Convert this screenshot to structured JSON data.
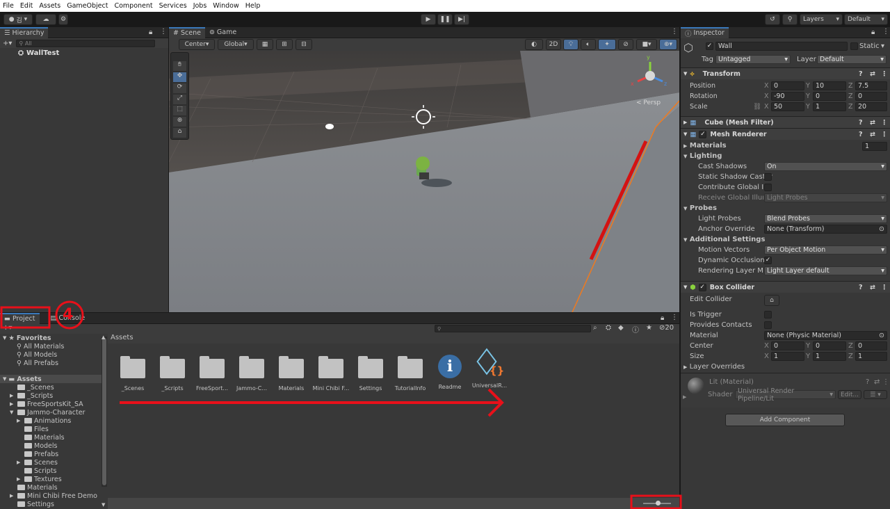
{
  "menu": [
    "File",
    "Edit",
    "Assets",
    "GameObject",
    "Component",
    "Services",
    "Jobs",
    "Window",
    "Help"
  ],
  "toolbar": {
    "account": "김",
    "layers": "Layers",
    "layout": "Default"
  },
  "hierarchy": {
    "tab": "Hierarchy",
    "search_placeholder": "All",
    "root": "WallTest"
  },
  "scene": {
    "tabs": [
      "Scene",
      "Game"
    ],
    "pivot": "Center",
    "space": "Global",
    "mode2d": "2D",
    "persp": "< Persp"
  },
  "inspector": {
    "tab": "Inspector",
    "object_name": "Wall",
    "static_label": "Static",
    "tag_label": "Tag",
    "tag_value": "Untagged",
    "layer_label": "Layer",
    "layer_value": "Default",
    "transform": {
      "title": "Transform",
      "rows": [
        {
          "label": "Position",
          "x": "0",
          "y": "10",
          "z": "7.5"
        },
        {
          "label": "Rotation",
          "x": "-90",
          "y": "0",
          "z": "0"
        },
        {
          "label": "Scale",
          "x": "50",
          "y": "1",
          "z": "20"
        }
      ]
    },
    "mesh_filter": "Cube (Mesh Filter)",
    "mesh_renderer": "Mesh Renderer",
    "materials_label": "Materials",
    "materials_count": "1",
    "lighting": "Lighting",
    "cast_shadows_label": "Cast Shadows",
    "cast_shadows": "On",
    "static_shadow": "Static Shadow Caster",
    "contribute_gi": "Contribute Global Illu",
    "receive_gi_label": "Receive Global Illumi",
    "receive_gi": "Light Probes",
    "probes": "Probes",
    "light_probes_label": "Light Probes",
    "light_probes": "Blend Probes",
    "anchor_label": "Anchor Override",
    "anchor": "None (Transform)",
    "additional": "Additional Settings",
    "motion_label": "Motion Vectors",
    "motion": "Per Object Motion",
    "dynamic_occ": "Dynamic Occlusion",
    "rendering_label": "Rendering Layer Mas",
    "rendering": "Light Layer default",
    "box_collider": "Box Collider",
    "edit_collider": "Edit Collider",
    "is_trigger": "Is Trigger",
    "provides_contacts": "Provides Contacts",
    "material_label": "Material",
    "material": "None (Physic Material)",
    "center_label": "Center",
    "center": {
      "x": "0",
      "y": "0",
      "z": "0"
    },
    "size_label": "Size",
    "size": {
      "x": "1",
      "y": "1",
      "z": "1"
    },
    "layer_overrides": "Layer Overrides",
    "lit_material": "Lit (Material)",
    "shader_label": "Shader",
    "shader": "Universal Render Pipeline/Lit",
    "edit_btn": "Edit...",
    "add_component": "Add Component"
  },
  "project": {
    "tabs": [
      "Project",
      "Console"
    ],
    "favorites": {
      "label": "Favorites",
      "items": [
        "All Materials",
        "All Models",
        "All Prefabs"
      ]
    },
    "assets_label": "Assets",
    "tree": [
      {
        "label": "_Scenes",
        "indent": 1,
        "arrow": false
      },
      {
        "label": "_Scripts",
        "indent": 1,
        "arrow": true
      },
      {
        "label": "FreeSportsKit_SA",
        "indent": 1,
        "arrow": true
      },
      {
        "label": "Jammo-Character",
        "indent": 1,
        "arrow": "open"
      },
      {
        "label": "Animations",
        "indent": 2,
        "arrow": true
      },
      {
        "label": "Files",
        "indent": 2,
        "arrow": false
      },
      {
        "label": "Materials",
        "indent": 2,
        "arrow": false
      },
      {
        "label": "Models",
        "indent": 2,
        "arrow": false
      },
      {
        "label": "Prefabs",
        "indent": 2,
        "arrow": false
      },
      {
        "label": "Scenes",
        "indent": 2,
        "arrow": true
      },
      {
        "label": "Scripts",
        "indent": 2,
        "arrow": false
      },
      {
        "label": "Textures",
        "indent": 2,
        "arrow": true
      },
      {
        "label": "Materials",
        "indent": 1,
        "arrow": false
      },
      {
        "label": "Mini Chibi Free Demo",
        "indent": 1,
        "arrow": true
      },
      {
        "label": "Settings",
        "indent": 1,
        "arrow": false
      }
    ],
    "breadcrumb": "Assets",
    "grid": [
      "_Scenes",
      "_Scripts",
      "FreeSport...",
      "Jammo-C...",
      "Materials",
      "Mini Chibi F...",
      "Settings",
      "TutorialInfo",
      "Readme",
      "UniversalR..."
    ],
    "hidden_count": "20"
  },
  "annotation": {
    "color": "#e8101a",
    "number": "4"
  }
}
